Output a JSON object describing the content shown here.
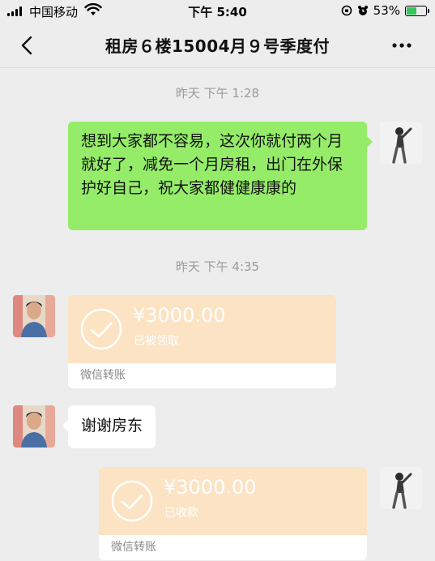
{
  "status_bar": {
    "carrier": "中国移动",
    "time": "下午 5:40",
    "battery": "53%"
  },
  "header": {
    "title": "租房６楼15004月９号季度付"
  },
  "messages": [
    {
      "timestamp": "昨天 下午 1:28"
    },
    {
      "text": "想到大家都不容易，这次你就付两个月就好了，减免一个月房租，出门在外保护好自己，祝大家都健健康康的"
    },
    {
      "timestamp": "昨天 下午 4:35"
    },
    {
      "amount": "¥3000.00",
      "status": "已被领取",
      "footer": "微信转账"
    },
    {
      "text": "谢谢房东"
    },
    {
      "amount": "¥3000.00",
      "status": "已收款",
      "footer": "微信转账"
    }
  ],
  "colors": {
    "bubble_green": "#95ec69",
    "transfer_peach": "#fbe3c4",
    "background": "#ededed"
  }
}
